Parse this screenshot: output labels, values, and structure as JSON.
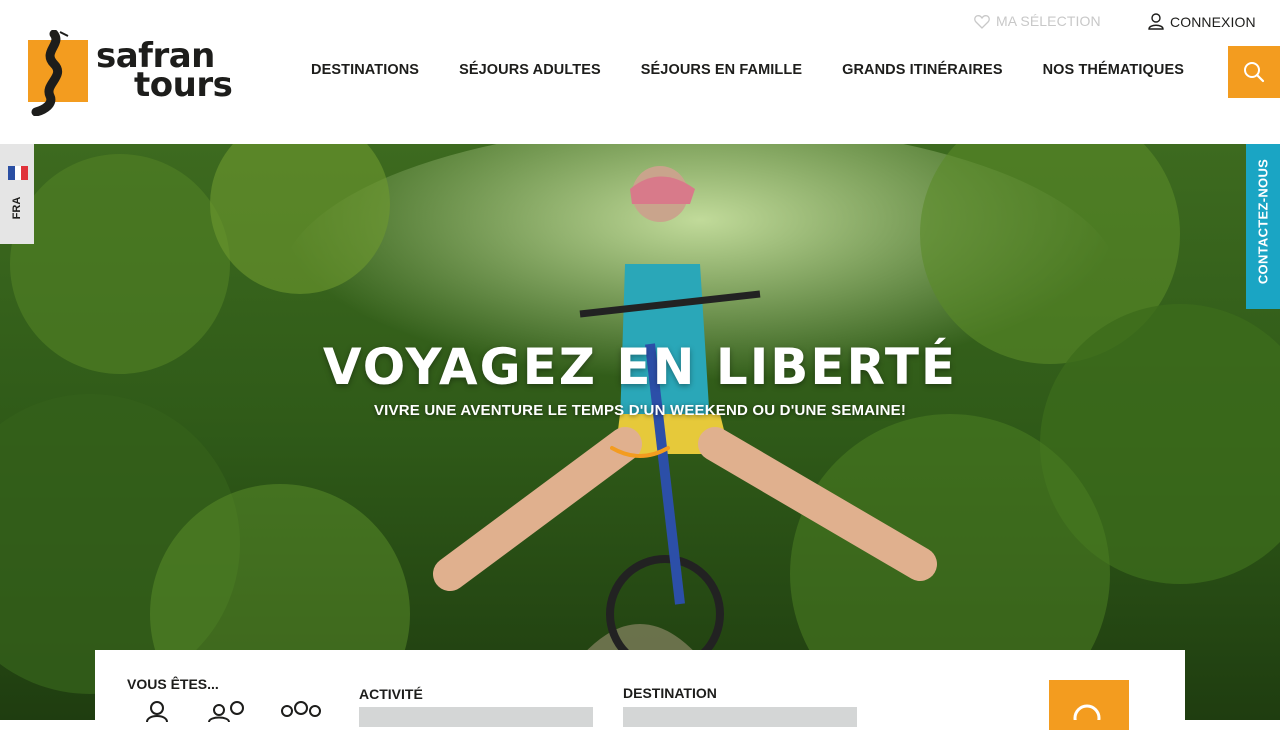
{
  "brand": {
    "name_line1": "safran",
    "name_line2": "tours",
    "accent_color": "#f39c1f",
    "contact_color": "#1aa5c4"
  },
  "topbar": {
    "selection_label": "MA SÉLECTION",
    "selection_icon": "heart-icon",
    "login_label": "CONNEXION",
    "login_icon": "user-icon"
  },
  "nav": {
    "items": [
      {
        "label": "DESTINATIONS"
      },
      {
        "label": "SÉJOURS ADULTES"
      },
      {
        "label": "SÉJOURS EN FAMILLE"
      },
      {
        "label": "GRANDS ITINÉRAIRES"
      },
      {
        "label": "NOS THÉMATIQUES"
      }
    ],
    "search_icon": "search-icon"
  },
  "side": {
    "language": "FRA",
    "contact": "CONTACTEZ-NOUS"
  },
  "hero": {
    "title": "VOYAGEZ EN LIBERTÉ",
    "subtitle": "VIVRE UNE AVENTURE LE TEMPS D'UN WEEKEND OU D'UNE SEMAINE!"
  },
  "search_panel": {
    "you_are_label": "VOUS ÊTES...",
    "activity_label": "ACTIVITÉ",
    "destination_label": "DESTINATION",
    "activity_value": "",
    "destination_value": ""
  }
}
